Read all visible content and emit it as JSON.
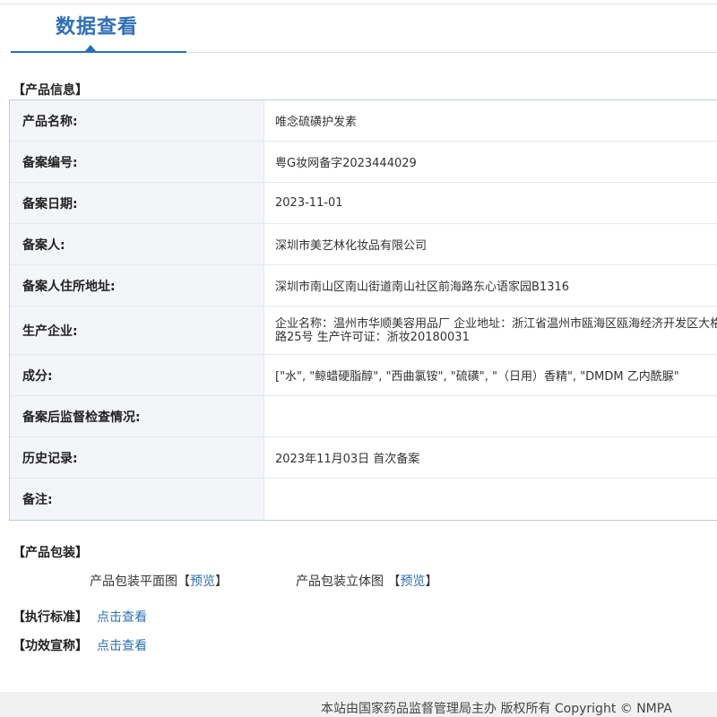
{
  "tab": {
    "title": "数据查看"
  },
  "product_info": {
    "section_title": "【产品信息】",
    "rows": [
      {
        "label": "产品名称:",
        "value": "唯念硫磺护发素"
      },
      {
        "label": "备案编号:",
        "value": "粤G妆网备字2023444029"
      },
      {
        "label": "备案日期:",
        "value": "2023-11-01"
      },
      {
        "label": "备案人:",
        "value": "深圳市美艺林化妆品有限公司"
      },
      {
        "label": "备案人住所地址:",
        "value": "深圳市南山区南山街道南山社区前海路东心语家园B1316"
      },
      {
        "label": "生产企业:",
        "value": "企业名称：温州市华顺美容用品厂 企业地址：浙江省温州市瓯海区瓯海经济开发区大格路25号 生产许可证：浙妆20180031"
      },
      {
        "label": "成分:",
        "value": "[\"水\", \"鲸蜡硬脂醇\", \"西曲氯铵\", \"硫磺\", \"（日用）香精\", \"DMDM 乙内酰脲\""
      },
      {
        "label": "备案后监督检查情况:",
        "value": ""
      },
      {
        "label": "历史记录:",
        "value": "2023年11月03日 首次备案"
      },
      {
        "label": "备注:",
        "value": ""
      }
    ]
  },
  "packaging": {
    "section_title": "【产品包装】",
    "flat_label": "产品包装平面图",
    "flat_link": "预览",
    "solid_label": "产品包装立体图",
    "solid_link": "预览"
  },
  "standard": {
    "label": "【执行标准】",
    "link": "点击查看"
  },
  "efficacy": {
    "label": "【功效宣称】",
    "link": "点击查看"
  },
  "footer": {
    "text": "本站由国家药品监督管理局主办 版权所有 Copyright © NMPA"
  }
}
